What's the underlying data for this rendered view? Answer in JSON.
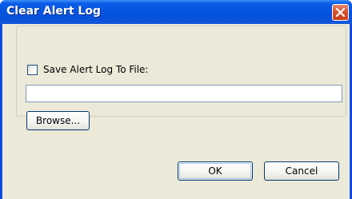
{
  "window": {
    "title": "Clear Alert Log"
  },
  "icons": {
    "close": "close-icon"
  },
  "options": {
    "save_checkbox_label": "Save Alert Log To File:",
    "save_checkbox_checked": false,
    "file_path_value": "",
    "browse_label": "Browse..."
  },
  "buttons": {
    "ok_label": "OK",
    "cancel_label": "Cancel"
  },
  "colors": {
    "titlebar": "#0555e0",
    "client_background": "#ece9d8",
    "close_button": "#d9532d",
    "button_border": "#003c74"
  }
}
